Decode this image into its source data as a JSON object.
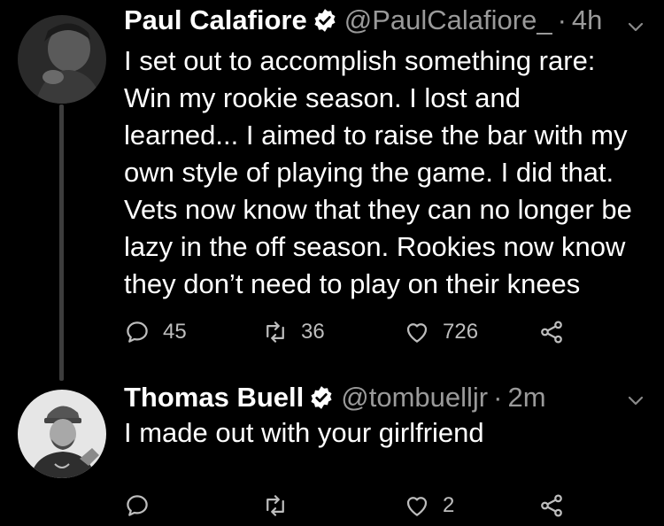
{
  "tweets": [
    {
      "name": "Paul Calafiore",
      "handle": "@PaulCalafiore_",
      "separator": "·",
      "time": "4h",
      "lines": [
        "I set out to accomplish something rare:",
        "Win my rookie season. I lost and",
        "learned... I aimed to raise the bar with my",
        "own style of playing the game. I did that.",
        "Vets now know that they can no longer be",
        "lazy in the off season. Rookies now know",
        "they don’t need to play on their knees"
      ],
      "replies": "45",
      "retweets": "36",
      "likes": "726"
    },
    {
      "name": "Thomas Buell",
      "handle": "@tombuelljr",
      "separator": "·",
      "time": "2m",
      "lines": [
        "I made out with your girlfriend"
      ],
      "replies": "",
      "retweets": "",
      "likes": "2"
    }
  ],
  "icons": {
    "verified": "verified-badge-icon",
    "more": "chevron-down-icon",
    "reply": "reply-icon",
    "retweet": "retweet-icon",
    "like": "heart-icon",
    "share": "share-icon"
  },
  "colors": {
    "background": "#000000",
    "text": "#ffffff",
    "secondary": "#9a9a9a",
    "thread_line": "#3d3d3d"
  }
}
